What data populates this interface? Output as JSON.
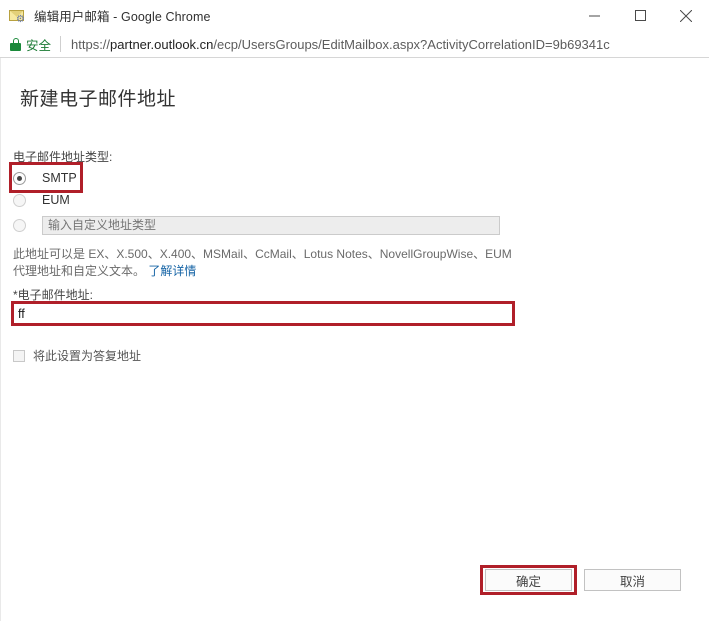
{
  "window": {
    "title": "编辑用户邮箱 - Google Chrome",
    "favicon_name": "mailbox-settings-icon",
    "controls": {
      "minimize": "minimize-icon",
      "maximize": "maximize-icon",
      "close": "close-icon"
    }
  },
  "omnibox": {
    "security_icon": "lock-icon",
    "security_label": "安全",
    "url_scheme": "https://",
    "url_host": "partner.outlook.cn",
    "url_path": "/ecp/UsersGroups/EditMailbox.aspx?ActivityCorrelationID=9b69341c",
    "url_full": "https://partner.outlook.cn/ecp/UsersGroups/EditMailbox.aspx?ActivityCorrelationID=9b69341c"
  },
  "dialog": {
    "title": "新建电子邮件地址",
    "type_label": "电子邮件地址类型:",
    "options": [
      {
        "id": "smtp",
        "label": "SMTP",
        "selected": true,
        "disabled": false
      },
      {
        "id": "eum",
        "label": "EUM",
        "selected": false,
        "disabled": true
      },
      {
        "id": "custom",
        "label": "",
        "selected": false,
        "disabled": true,
        "placeholder": "输入自定义地址类型"
      }
    ],
    "hint_text": "此地址可以是 EX、X.500、X.400、MSMail、CcMail、Lotus Notes、NovellGroupWise、EUM 代理地址和自定义文本。",
    "hint_link": "了解详情",
    "email_label": "*电子邮件地址:",
    "email_value": "ff",
    "reply_checkbox_label": "将此设置为答复地址",
    "reply_checkbox_checked": false,
    "ok_label": "确定",
    "cancel_label": "取消"
  },
  "annotations": {
    "color": "#b01f29",
    "targets": [
      "smtp-radio-option",
      "email-address-input",
      "ok-button"
    ]
  }
}
